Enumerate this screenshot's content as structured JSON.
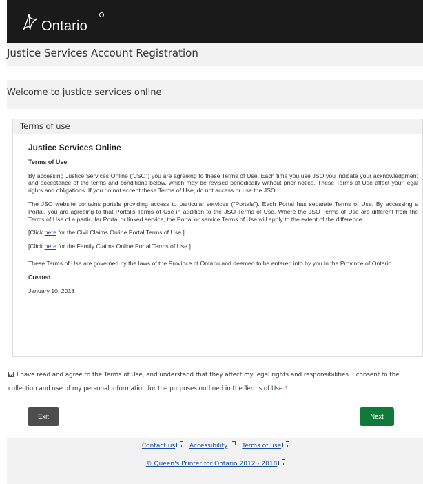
{
  "header": {
    "logo_text": "Ontario",
    "logo_icon": "ontario-trillium-icon"
  },
  "app": {
    "title": "Justice Services Account Registration"
  },
  "welcome": {
    "heading": "Welcome to justice services online"
  },
  "terms_panel": {
    "header": "Terms of use",
    "doc_title": "Justice Services Online",
    "doc_subtitle": "Terms of Use",
    "para1": "By accessing Justice Services Online (\"JSO\") you are agreeing to these Terms of Use. Each time you use JSO you indicate your acknowledgment and acceptance of the terms and conditions below, which may be revised periodically without prior notice. These Terms of Use affect your legal rights and obligations. If you do not accept these Terms of Use, do not access or use the JSO.",
    "para2": "The JSO website contains portals providing access to particular services (\"Portals\"). Each Portal has separate Terms of Use. By accessing a Portal, you are agreeing to that Portal's Terms of Use in addition to the JSO Terms of Use. Where the JSO Terms of Use are different from the Terms of Use of a particular Portal or linked service, the Portal or service Terms of Use will apply to the extent of the difference.",
    "civil_prefix": "[Click ",
    "civil_link": "here",
    "civil_suffix": " for the Civil Claims Online Portal Terms of Use.]",
    "family_prefix": "[Click ",
    "family_link": "here",
    "family_suffix": " for the Family Claims Online Portal Terms of Use.]",
    "para3": "These Terms of Use are governed by the laws of the Province of Ontario and deemed to be entered into by you in the Province of Ontario.",
    "created_label": "Created",
    "created_date": "January 10, 2018"
  },
  "agreement": {
    "checked": true,
    "text": "I have read and agree to the Terms of Use, and understand that they affect my legal rights and responsibilities. I consent to the collection and use of my personal information for the purposes outlined in the Terms of Use.",
    "required_mark": "*"
  },
  "buttons": {
    "exit": "Exit",
    "next": "Next",
    "exit_color": "#4d4d4d",
    "next_color": "#0f7a3a"
  },
  "footer": {
    "contact": "Contact us",
    "accessibility": "Accessibility",
    "terms": "Terms of use",
    "copyright": "© Queen's Printer for Ontario 2012 - 2018",
    "external_icon": "external-link-icon"
  },
  "colors": {
    "header_bg": "#1a1a1a",
    "band_bg": "#f2f2f2",
    "link": "#1a4fa0",
    "required": "#c8102e"
  }
}
